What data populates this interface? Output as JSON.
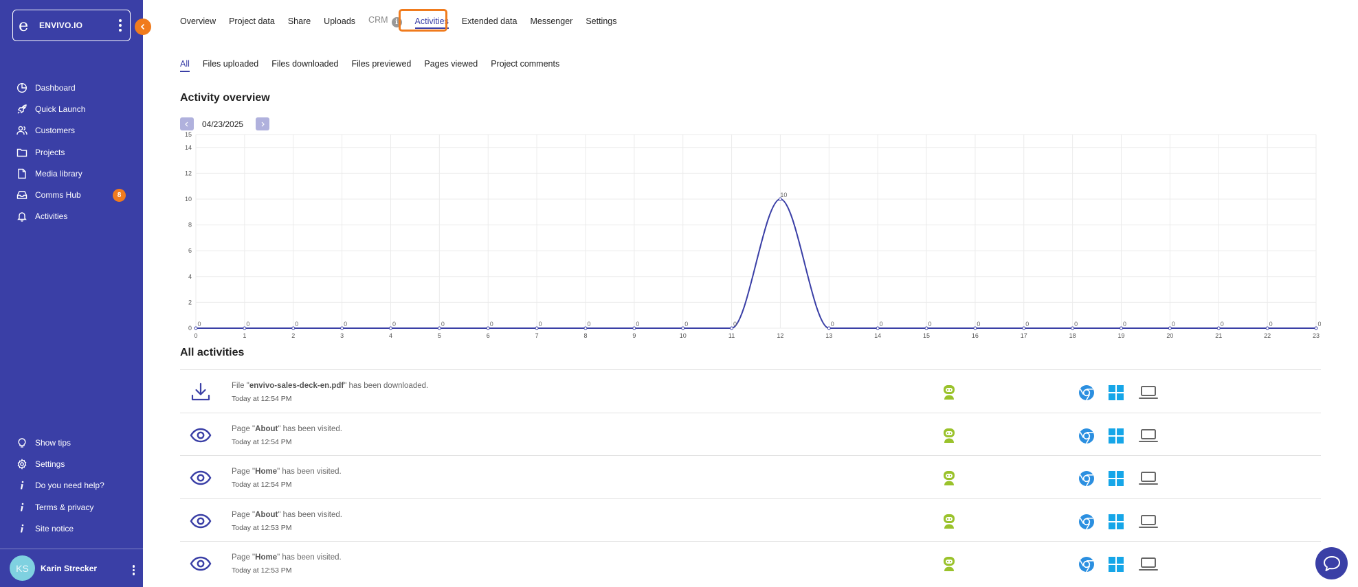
{
  "brand": {
    "logo_letter": "e",
    "name": "ENVIVO.IO"
  },
  "sidebar": {
    "items": [
      {
        "label": "Dashboard",
        "icon": "dashboard-icon"
      },
      {
        "label": "Quick Launch",
        "icon": "rocket-icon"
      },
      {
        "label": "Customers",
        "icon": "users-icon"
      },
      {
        "label": "Projects",
        "icon": "folder-icon"
      },
      {
        "label": "Media library",
        "icon": "file-icon"
      },
      {
        "label": "Comms Hub",
        "icon": "inbox-icon",
        "badge": "8"
      },
      {
        "label": "Activities",
        "icon": "bell-icon"
      }
    ],
    "bottom_items": [
      {
        "label": "Show tips",
        "icon": "lightbulb-icon"
      },
      {
        "label": "Settings",
        "icon": "gear-icon"
      },
      {
        "label": "Do you need help?",
        "icon": "info-icon"
      },
      {
        "label": "Terms & privacy",
        "icon": "info-icon"
      },
      {
        "label": "Site notice",
        "icon": "info-icon"
      }
    ],
    "user": {
      "initials": "KS",
      "name": "Karin Strecker"
    }
  },
  "tabs": [
    {
      "label": "Overview",
      "state": "normal"
    },
    {
      "label": "Project data",
      "state": "normal"
    },
    {
      "label": "Share",
      "state": "normal"
    },
    {
      "label": "Uploads",
      "state": "normal"
    },
    {
      "label": "CRM",
      "state": "muted"
    },
    {
      "label": "Activities",
      "state": "active"
    },
    {
      "label": "Extended data",
      "state": "normal"
    },
    {
      "label": "Messenger",
      "state": "normal"
    },
    {
      "label": "Settings",
      "state": "normal"
    }
  ],
  "subtabs": [
    {
      "label": "All",
      "active": true
    },
    {
      "label": "Files uploaded",
      "active": false
    },
    {
      "label": "Files downloaded",
      "active": false
    },
    {
      "label": "Files previewed",
      "active": false
    },
    {
      "label": "Pages viewed",
      "active": false
    },
    {
      "label": "Project comments",
      "active": false
    }
  ],
  "overview": {
    "title": "Activity overview",
    "date": "04/23/2025"
  },
  "chart_data": {
    "type": "line",
    "x": [
      0,
      1,
      2,
      3,
      4,
      5,
      6,
      7,
      8,
      9,
      10,
      11,
      12,
      13,
      14,
      15,
      16,
      17,
      18,
      19,
      20,
      21,
      22,
      23
    ],
    "series": [
      {
        "values": [
          0,
          0,
          0,
          0,
          0,
          0,
          0,
          0,
          0,
          0,
          0,
          0,
          10,
          0,
          0,
          0,
          0,
          0,
          0,
          0,
          0,
          0,
          0,
          0
        ]
      }
    ],
    "xlim": [
      0,
      23
    ],
    "ylim": [
      0,
      15
    ],
    "yticks": [
      0,
      2,
      4,
      6,
      8,
      10,
      12,
      14,
      15
    ],
    "grid": true,
    "smooth": true,
    "data_labels": true,
    "color": "#3a3fa6"
  },
  "activities": {
    "title": "All activities",
    "rows": [
      {
        "icon": "download-icon",
        "prefix": "File \"",
        "name": "envivo-sales-deck-en.pdf",
        "suffix": "\" has been downloaded.",
        "time": "Today at 12:54 PM"
      },
      {
        "icon": "eye-icon",
        "prefix": "Page \"",
        "name": "About",
        "suffix": "\" has been visited.",
        "time": "Today at 12:54 PM"
      },
      {
        "icon": "eye-icon",
        "prefix": "Page \"",
        "name": "Home",
        "suffix": "\" has been visited.",
        "time": "Today at 12:54 PM"
      },
      {
        "icon": "eye-icon",
        "prefix": "Page \"",
        "name": "About",
        "suffix": "\" has been visited.",
        "time": "Today at 12:53 PM"
      },
      {
        "icon": "eye-icon",
        "prefix": "Page \"",
        "name": "Home",
        "suffix": "\" has been visited.",
        "time": "Today at 12:53 PM"
      }
    ]
  },
  "colors": {
    "sidebar": "#3a3fa6",
    "accent_orange": "#f07b1d",
    "visitor_green": "#9ac22b",
    "chrome_blue": "#2b8fe0",
    "windows_blue": "#16a6e8",
    "laptop_gray": "#666666"
  }
}
